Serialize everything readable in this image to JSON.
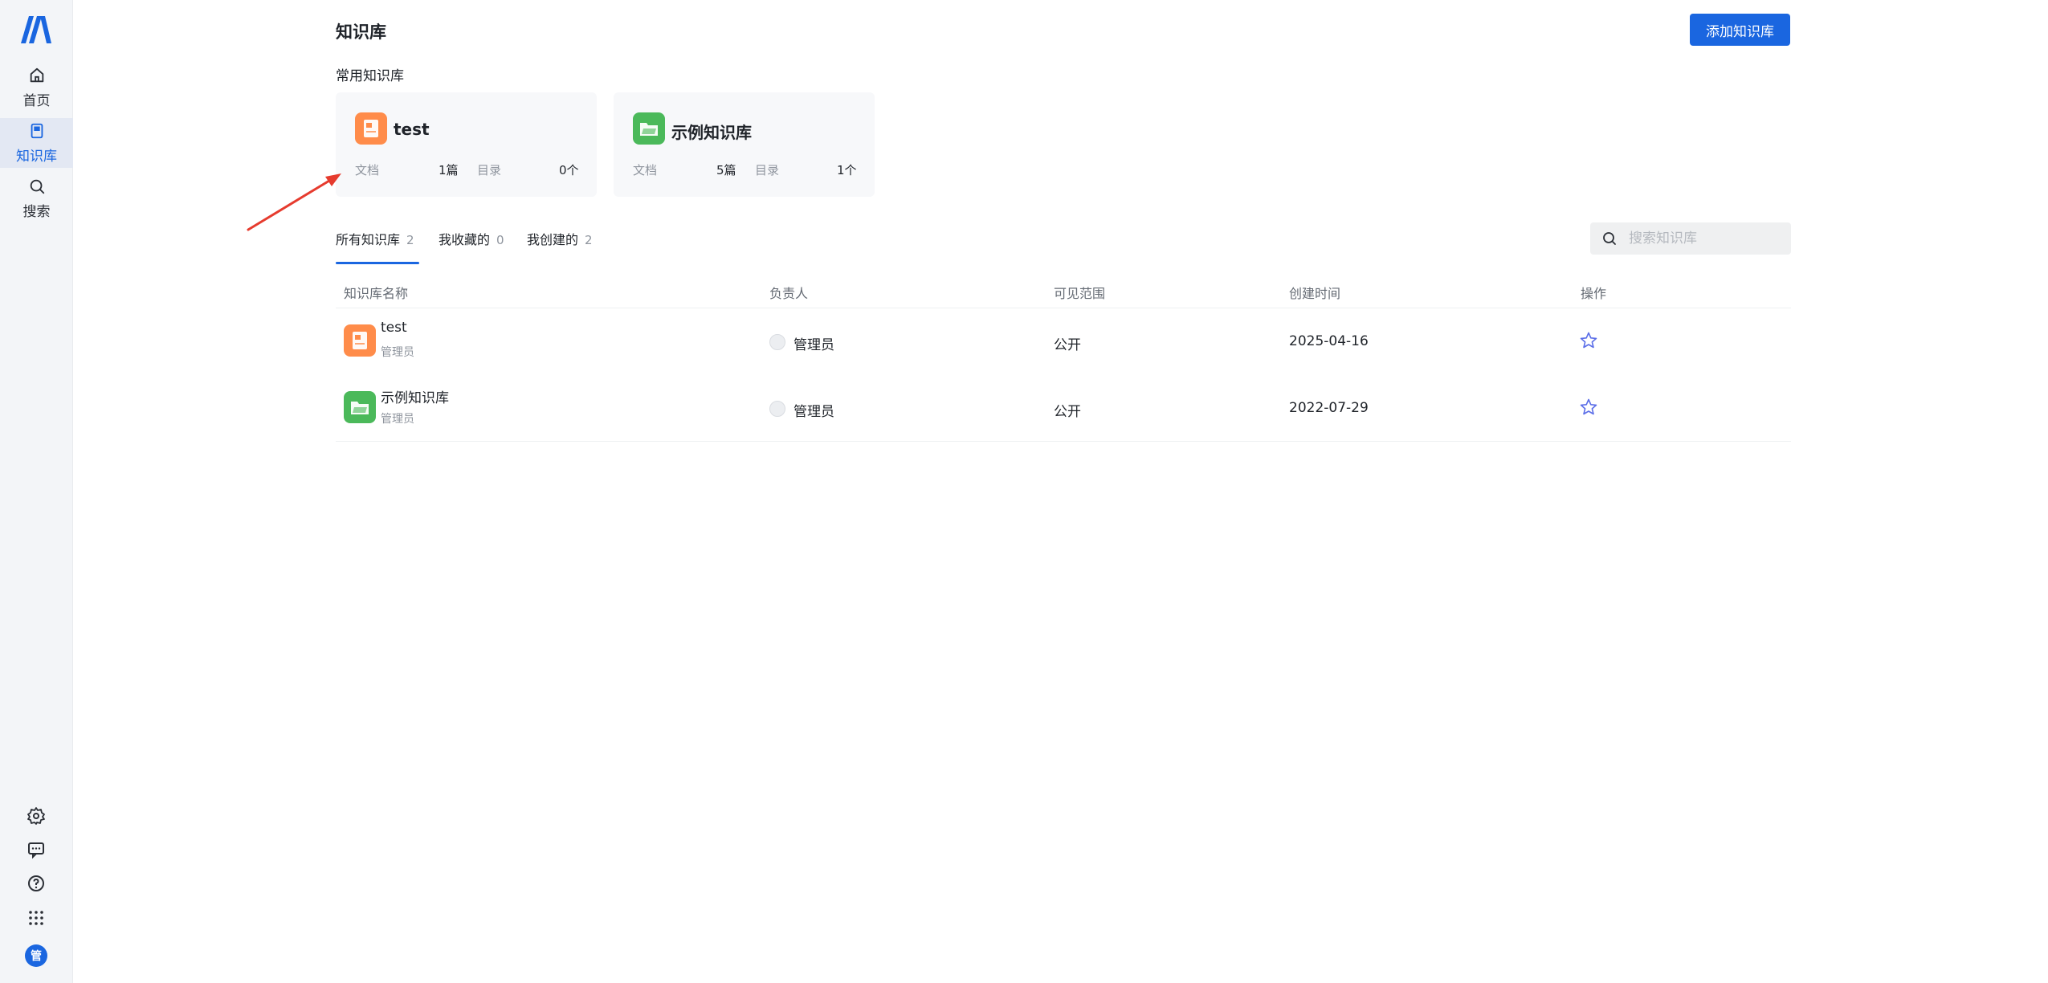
{
  "sidebar": {
    "logo": "app-logo",
    "items": [
      {
        "label": "首页",
        "icon": "home-icon"
      },
      {
        "label": "知识库",
        "icon": "book-icon",
        "active": true
      },
      {
        "label": "搜索",
        "icon": "search-icon"
      }
    ],
    "bottom_icons": [
      "settings-icon",
      "message-icon",
      "help-icon",
      "apps-grid-icon"
    ],
    "avatar_text": "管"
  },
  "header": {
    "title": "知识库",
    "add_button": "添加知识库"
  },
  "frequent": {
    "title": "常用知识库",
    "cards": [
      {
        "name": "test",
        "icon": "doc-icon",
        "color": "#ff8c4a",
        "doc_label": "文档",
        "doc_count": "1篇",
        "dir_label": "目录",
        "dir_count": "0个"
      },
      {
        "name": "示例知识库",
        "icon": "folder-icon",
        "color": "#4bb95a",
        "doc_label": "文档",
        "doc_count": "5篇",
        "dir_label": "目录",
        "dir_count": "1个"
      }
    ]
  },
  "tabs": [
    {
      "label": "所有知识库",
      "count": "2",
      "active": true
    },
    {
      "label": "我收藏的",
      "count": "0"
    },
    {
      "label": "我创建的",
      "count": "2"
    }
  ],
  "search": {
    "placeholder": "搜索知识库"
  },
  "table": {
    "headers": [
      "知识库名称",
      "负责人",
      "可见范围",
      "创建时间",
      "操作"
    ],
    "rows": [
      {
        "name": "test",
        "sub": "管理员",
        "owner": "管理员",
        "scope": "公开",
        "created": "2025-04-16",
        "icon": "doc-icon",
        "color": "#ff8c4a"
      },
      {
        "name": "示例知识库",
        "sub": "管理员",
        "owner": "管理员",
        "scope": "公开",
        "created": "2022-07-29",
        "icon": "folder-icon",
        "color": "#4bb95a"
      }
    ]
  },
  "colors": {
    "accent": "#1a66e0",
    "annotation_arrow": "#e63b2e"
  }
}
